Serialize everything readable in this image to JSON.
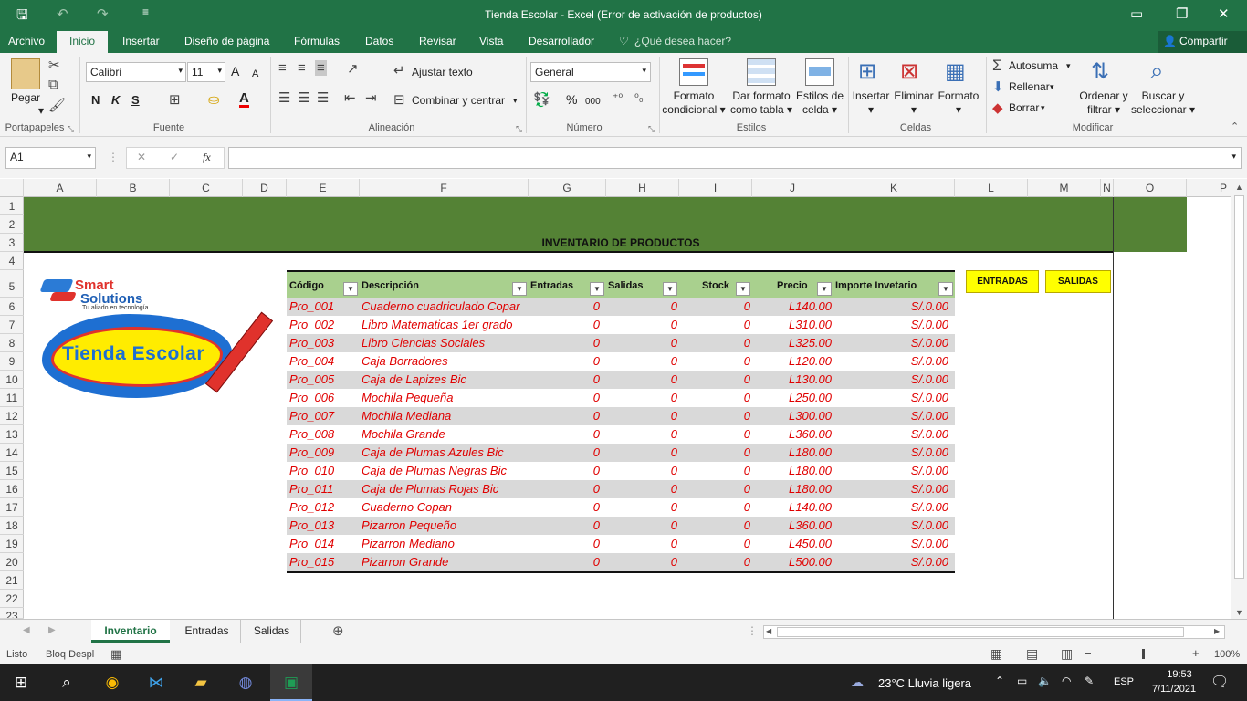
{
  "window": {
    "title": "Tienda Escolar - Excel (Error de activación de productos)"
  },
  "ribbon_tabs": [
    "Archivo",
    "Inicio",
    "Insertar",
    "Diseño de página",
    "Fórmulas",
    "Datos",
    "Revisar",
    "Vista",
    "Desarrollador"
  ],
  "tell_me": "¿Qué desea hacer?",
  "share": "Compartir",
  "clipboard": {
    "paste": "Pegar",
    "label": "Portapapeles"
  },
  "font": {
    "name": "Calibri",
    "size": "11",
    "bold": "N",
    "italic": "K",
    "underline": "S",
    "grow": "A",
    "shrink": "A",
    "color_glyph": "A",
    "label": "Fuente"
  },
  "alignment": {
    "wrap": "Ajustar texto",
    "merge": "Combinar y centrar",
    "label": "Alineación"
  },
  "number": {
    "format": "General",
    "percent": "%",
    "thousands": "000",
    "label": "Número"
  },
  "styles": {
    "cond_l1": "Formato",
    "cond_l2": "condicional",
    "table_l1": "Dar formato",
    "table_l2": "como tabla",
    "cell_l1": "Estilos de",
    "cell_l2": "celda",
    "label": "Estilos"
  },
  "cells": {
    "insert": "Insertar",
    "delete": "Eliminar",
    "format": "Formato",
    "label": "Celdas"
  },
  "editing": {
    "autosum": "Autosuma",
    "fill": "Rellenar",
    "clear": "Borrar",
    "sort_l1": "Ordenar y",
    "sort_l2": "filtrar",
    "find_l1": "Buscar y",
    "find_l2": "seleccionar",
    "label": "Modificar"
  },
  "formula_bar": {
    "name_box": "A1",
    "fx": "fx",
    "value": ""
  },
  "columns": [
    "A",
    "B",
    "C",
    "D",
    "E",
    "F",
    "G",
    "H",
    "I",
    "J",
    "K",
    "L",
    "M",
    "N",
    "O",
    "P"
  ],
  "rows": [
    "1",
    "2",
    "3",
    "4",
    "5",
    "6",
    "7",
    "8",
    "9",
    "10",
    "11",
    "12",
    "13",
    "14",
    "15",
    "16",
    "17",
    "18",
    "19",
    "20",
    "21",
    "22",
    "23"
  ],
  "sheet": {
    "title": "INVENTARIO DE PRODUCTOS",
    "logo_brand1": "Smart",
    "logo_brand2": "Solutions",
    "logo_tagline": "Tu aliado en tecnología",
    "logo_main": "Tienda Escolar",
    "btn_entradas": "ENTRADAS",
    "btn_salidas": "SALIDAS",
    "headers": [
      "Código",
      "Descripción",
      "Entradas",
      "Salidas",
      "Stock",
      "Precio",
      "Importe Invetario"
    ],
    "rows": [
      [
        "Pro_001",
        "Cuaderno cuadriculado Copar",
        "0",
        "0",
        "0",
        "L140.00",
        "S/.0.00"
      ],
      [
        "Pro_002",
        "Libro Matematicas 1er grado",
        "0",
        "0",
        "0",
        "L310.00",
        "S/.0.00"
      ],
      [
        "Pro_003",
        "Libro Ciencias Sociales",
        "0",
        "0",
        "0",
        "L325.00",
        "S/.0.00"
      ],
      [
        "Pro_004",
        "Caja Borradores",
        "0",
        "0",
        "0",
        "L120.00",
        "S/.0.00"
      ],
      [
        "Pro_005",
        "Caja de Lapizes Bic",
        "0",
        "0",
        "0",
        "L130.00",
        "S/.0.00"
      ],
      [
        "Pro_006",
        "Mochila Pequeña",
        "0",
        "0",
        "0",
        "L250.00",
        "S/.0.00"
      ],
      [
        "Pro_007",
        "Mochila Mediana",
        "0",
        "0",
        "0",
        "L300.00",
        "S/.0.00"
      ],
      [
        "Pro_008",
        "Mochila Grande",
        "0",
        "0",
        "0",
        "L360.00",
        "S/.0.00"
      ],
      [
        "Pro_009",
        "Caja de Plumas Azules Bic",
        "0",
        "0",
        "0",
        "L180.00",
        "S/.0.00"
      ],
      [
        "Pro_010",
        "Caja de Plumas Negras Bic",
        "0",
        "0",
        "0",
        "L180.00",
        "S/.0.00"
      ],
      [
        "Pro_011",
        "Caja de Plumas Rojas Bic",
        "0",
        "0",
        "0",
        "L180.00",
        "S/.0.00"
      ],
      [
        "Pro_012",
        "Cuaderno Copan",
        "0",
        "0",
        "0",
        "L140.00",
        "S/.0.00"
      ],
      [
        "Pro_013",
        "Pizarron Pequeño",
        "0",
        "0",
        "0",
        "L360.00",
        "S/.0.00"
      ],
      [
        "Pro_014",
        "Pizarron Mediano",
        "0",
        "0",
        "0",
        "L450.00",
        "S/.0.00"
      ],
      [
        "Pro_015",
        "Pizarron Grande",
        "0",
        "0",
        "0",
        "L500.00",
        "S/.0.00"
      ]
    ]
  },
  "sheet_tabs": [
    "Inventario",
    "Entradas",
    "Salidas"
  ],
  "status": {
    "ready": "Listo",
    "scroll_lock": "Bloq Despl",
    "zoom": "100%"
  },
  "taskbar": {
    "weather": "23°C  Lluvia ligera",
    "lang": "ESP",
    "time": "19:53",
    "date": "7/11/2021"
  },
  "colors": {
    "excel_green": "#217346",
    "band_green": "#548235",
    "table_header": "#a9d08e",
    "row_stripe": "#d9d9d9",
    "data_red": "#e00000",
    "button_yellow": "#ffff00"
  }
}
